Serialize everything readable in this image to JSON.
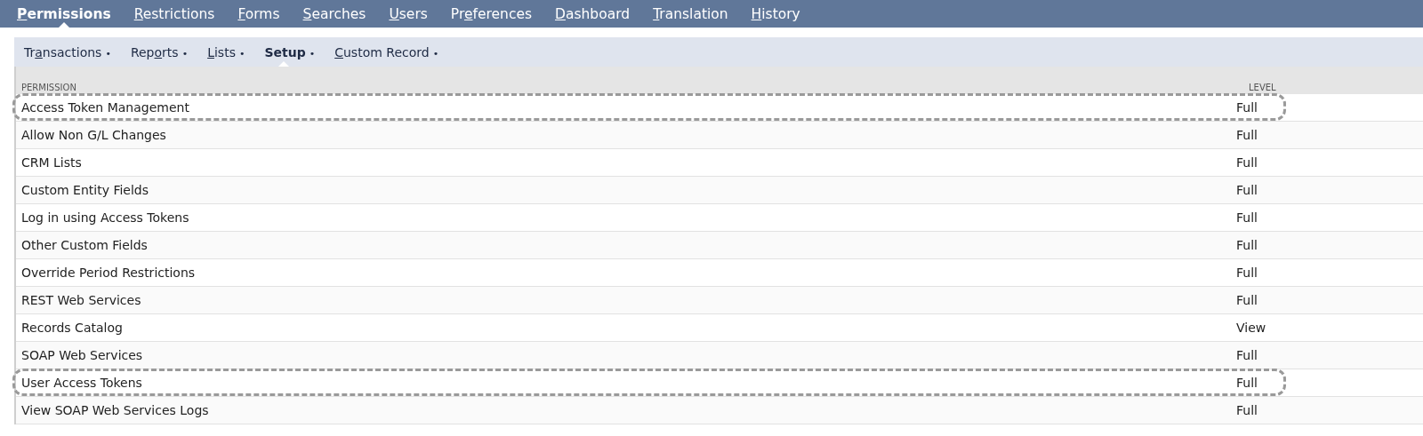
{
  "main_tabs": [
    {
      "key": "P",
      "post": "ermissions",
      "selected": true
    },
    {
      "key": "R",
      "post": "estrictions",
      "selected": false
    },
    {
      "key": "F",
      "post": "orms",
      "selected": false
    },
    {
      "key": "S",
      "post": "earches",
      "selected": false
    },
    {
      "key": "U",
      "post": "sers",
      "selected": false
    },
    {
      "pre": "Pr",
      "key": "e",
      "post": "ferences",
      "selected": false
    },
    {
      "key": "D",
      "post": "ashboard",
      "selected": false
    },
    {
      "key": "T",
      "post": "ranslation",
      "selected": false
    },
    {
      "key": "H",
      "post": "istory",
      "selected": false
    }
  ],
  "sub_tabs": [
    {
      "pre": "Tr",
      "key": "a",
      "post": "nsactions",
      "marker": "•",
      "selected": false
    },
    {
      "pre": "Rep",
      "key": "o",
      "post": "rts",
      "marker": "•",
      "selected": false
    },
    {
      "key": "L",
      "post": "ists",
      "marker": "•",
      "selected": false
    },
    {
      "pre": "Setup",
      "marker": "•",
      "selected": true
    },
    {
      "key": "C",
      "post": "ustom Record",
      "marker": "•",
      "selected": false
    }
  ],
  "table": {
    "columns": [
      "PERMISSION",
      "LEVEL"
    ],
    "rows": [
      {
        "permission": "Access Token Management",
        "level": "Full",
        "highlighted": true
      },
      {
        "permission": "Allow Non G/L Changes",
        "level": "Full",
        "highlighted": false
      },
      {
        "permission": "CRM Lists",
        "level": "Full",
        "highlighted": false
      },
      {
        "permission": "Custom Entity Fields",
        "level": "Full",
        "highlighted": false
      },
      {
        "permission": "Log in using Access Tokens",
        "level": "Full",
        "highlighted": false
      },
      {
        "permission": "Other Custom Fields",
        "level": "Full",
        "highlighted": false
      },
      {
        "permission": "Override Period Restrictions",
        "level": "Full",
        "highlighted": false
      },
      {
        "permission": "REST Web Services",
        "level": "Full",
        "highlighted": false
      },
      {
        "permission": "Records Catalog",
        "level": "View",
        "highlighted": false
      },
      {
        "permission": "SOAP Web Services",
        "level": "Full",
        "highlighted": false
      },
      {
        "permission": "User Access Tokens",
        "level": "Full",
        "highlighted": true
      },
      {
        "permission": "View SOAP Web Services Logs",
        "level": "Full",
        "highlighted": false
      }
    ]
  }
}
